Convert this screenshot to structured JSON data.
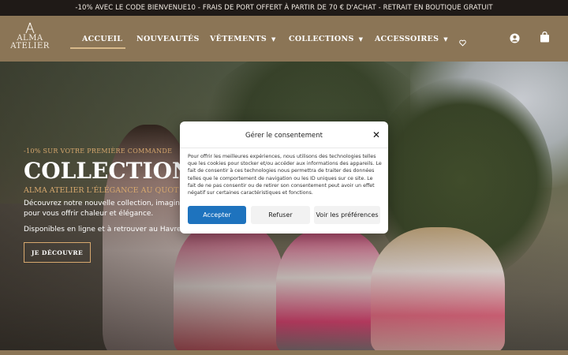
{
  "announcement": "-10% AVEC LE CODE BIENVENUE10 - FRAIS DE PORT OFFERT À PARTIR DE 70 € D'ACHAT - RETRAIT EN BOUTIQUE GRATUIT",
  "logo": {
    "line1": "ALMA",
    "line2": "ATELIER"
  },
  "nav": {
    "accueil": "ACCUEIL",
    "nouveautes": "NOUVEAUTÉS",
    "vetements": "VÊTEMENTS",
    "collections": "COLLECTIONS",
    "accessoires": "ACCESSOIRES"
  },
  "icons": {
    "wishlist": "heart-icon",
    "account": "user-icon",
    "cart": "bag-icon",
    "dropdown": "caret-down-icon"
  },
  "hero": {
    "eyebrow": "-10% SUR VOTRE PREMIÈRE COMMANDE",
    "title": "COLLECTION P",
    "tagline": "ALMA ATELIER L'ÉLÉGANCE AU QUOT",
    "text_line1": "Découvrez notre nouvelle collection, imaginée",
    "text_line2": "pour vous offrir chaleur et élégance.",
    "text_line3": "Disponibles en ligne et à retrouver au Havre, e",
    "button": "JE DÉCOUVRE"
  },
  "consent": {
    "title": "Gérer le consentement",
    "body": "Pour offrir les meilleures expériences, nous utilisons des technologies telles que les cookies pour stocker et/ou accéder aux informations des appareils. Le fait de consentir à ces technologies nous permettra de traiter des données telles que le comportement de navigation ou les ID uniques sur ce site. Le fait de ne pas consentir ou de retirer son consentement peut avoir un effet négatif sur certaines caractéristiques et fonctions.",
    "accept": "Accepter",
    "refuse": "Refuser",
    "preferences": "Voir les préférences"
  },
  "colors": {
    "header": "#8b7556",
    "topbar": "#1f1a17",
    "accent": "#d7a86e",
    "primary_button": "#1e73be"
  }
}
